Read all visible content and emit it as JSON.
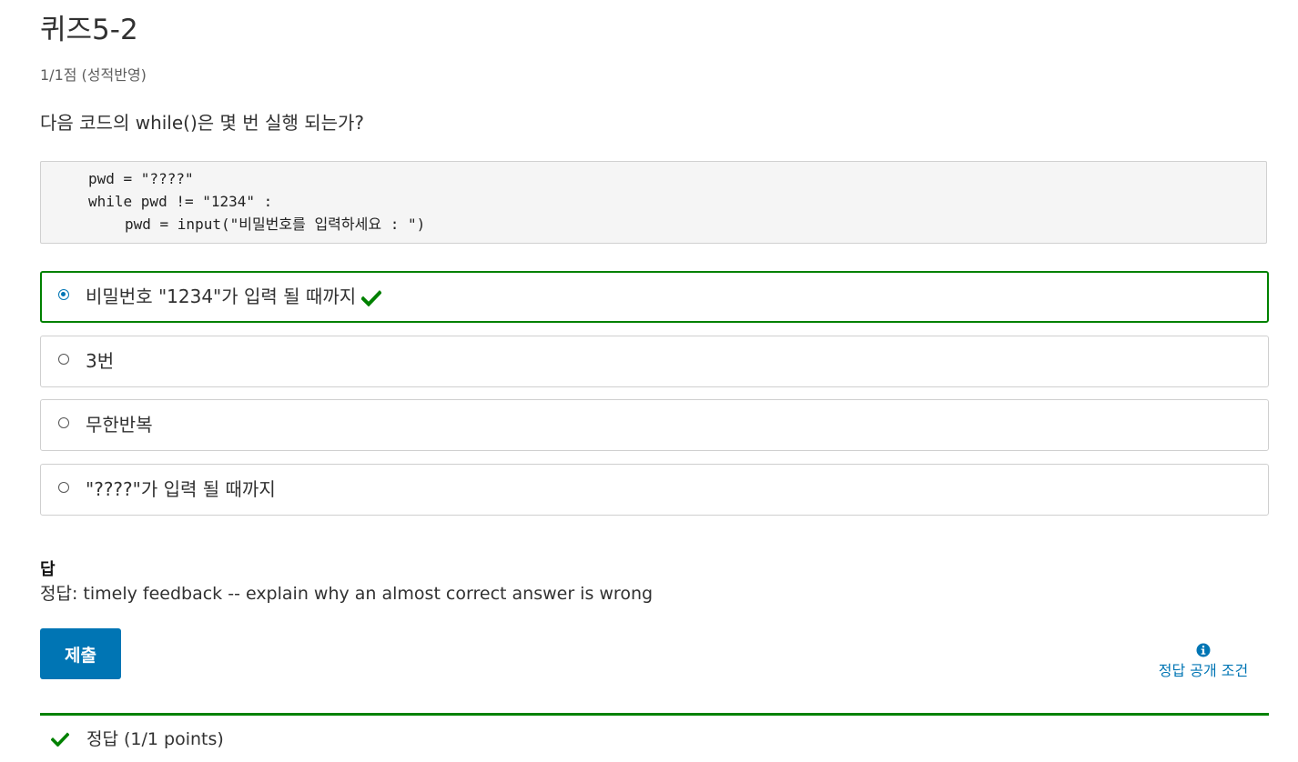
{
  "title": "퀴즈5-2",
  "score": "1/1점 (성적반영)",
  "question": "다음 코드의 while()은 몇 번 실행 되는가?",
  "code": {
    "line1": "pwd = \"????\"",
    "line2": "while pwd != \"1234\" :",
    "line3": "pwd = input(\"비밀번호를 입력하세요 : \")"
  },
  "options": [
    {
      "label": "비밀번호 \"1234\"가 입력 될 때까지",
      "selected": true,
      "correct": true
    },
    {
      "label": "3번",
      "selected": false
    },
    {
      "label": "무한반복",
      "selected": false
    },
    {
      "label": "\"????\"가 입력 될 때까지",
      "selected": false
    }
  ],
  "answer": {
    "heading": "답",
    "text": "정답:  timely feedback -- explain why an almost correct answer is wrong"
  },
  "submit_label": "제출",
  "reveal_label": "정답 공개 조건",
  "feedback": "정답 (1/1 points)",
  "colors": {
    "accent": "#0075b4",
    "correct": "#008100"
  },
  "icons": {
    "correct": "check-icon",
    "info": "info-circle-icon"
  }
}
